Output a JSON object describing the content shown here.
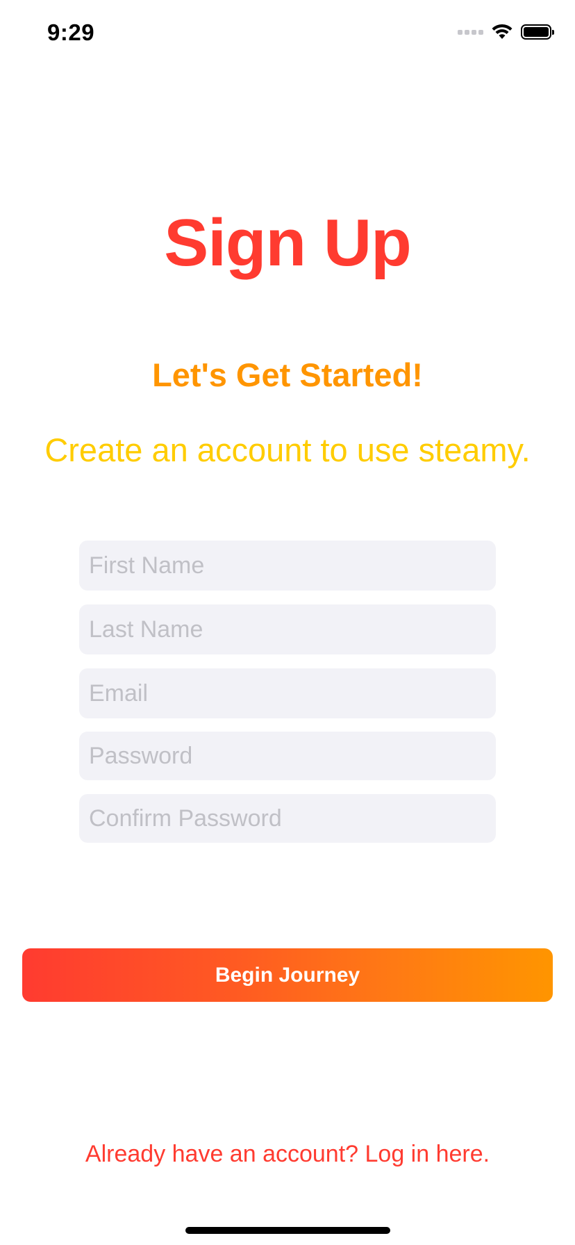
{
  "status_bar": {
    "time": "9:29"
  },
  "header": {
    "title": "Sign Up",
    "subtitle": "Let's Get Started!",
    "tagline": "Create an account to use steamy."
  },
  "form": {
    "first_name_placeholder": "First Name",
    "last_name_placeholder": "Last Name",
    "email_placeholder": "Email",
    "password_placeholder": "Password",
    "confirm_password_placeholder": "Confirm Password"
  },
  "actions": {
    "primary_label": "Begin Journey",
    "login_link_label": "Already have an account? Log in here."
  },
  "colors": {
    "title": "#ff3b30",
    "subtitle": "#ff9500",
    "tagline": "#ffcc00",
    "field_background": "#f2f2f7",
    "button_gradient_start": "#ff3b30",
    "button_gradient_end": "#ff9500",
    "link": "#ff3b30"
  },
  "icons": [
    "cellular-signal-icon",
    "wifi-icon",
    "battery-icon"
  ]
}
